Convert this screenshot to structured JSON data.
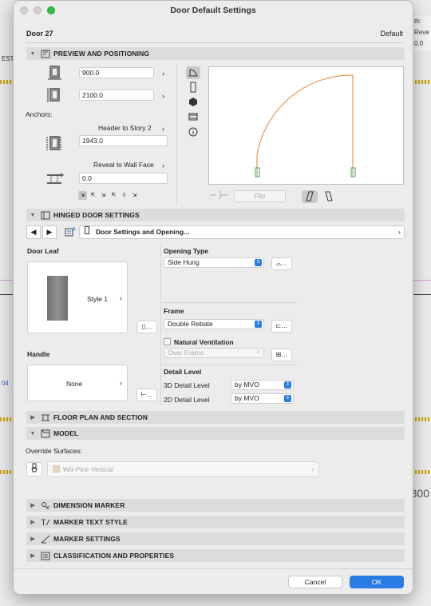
{
  "window": {
    "title": "Door Default Settings"
  },
  "header": {
    "element_name": "Door 27",
    "default_label": "Default"
  },
  "background": {
    "right_labels": [
      "th:",
      "Reve",
      "0.0"
    ],
    "left_labels": [
      "EST",
      "04"
    ],
    "number": "300"
  },
  "sections": {
    "preview": "PREVIEW AND POSITIONING",
    "hinged": "HINGED DOOR SETTINGS",
    "floor_plan": "FLOOR PLAN AND SECTION",
    "model": "MODEL",
    "dimension_marker": "DIMENSION MARKER",
    "marker_text": "MARKER TEXT STYLE",
    "marker_settings": "MARKER SETTINGS",
    "classification": "CLASSIFICATION AND PROPERTIES"
  },
  "preview": {
    "width_value": "900.0",
    "height_value": "2100.0",
    "anchors_label": "Anchors:",
    "anchor_select": "Header to Story 2",
    "anchor_value": "1943.0",
    "reveal_select": "Reveal to Wall Face",
    "reveal_value": "0.0",
    "flip_label": "Flip"
  },
  "hinged": {
    "nav_label": "Door Settings and Opening...",
    "door_leaf_label": "Door Leaf",
    "door_leaf_style": "Style 1",
    "handle_label": "Handle",
    "handle_style": "None",
    "opening_type_label": "Opening Type",
    "opening_type_value": "Side Hung",
    "frame_label": "Frame",
    "frame_value": "Double Rebate",
    "natural_vent_label": "Natural Ventilation",
    "vent_value": "Over Frame",
    "detail_level_label": "Detail Level",
    "detail_3d_label": "3D Detail Level",
    "detail_3d_value": "by MVO",
    "detail_2d_label": "2D Detail Level",
    "detail_2d_value": "by MVO"
  },
  "model": {
    "override_label": "Override Surfaces:",
    "surface_value": "Wd-Pine Vertical"
  },
  "footer": {
    "cancel": "Cancel",
    "ok": "OK"
  },
  "colors": {
    "accent": "#2a7be4",
    "door_swing": "#f0822a",
    "frame_marker": "#3fae3f"
  }
}
